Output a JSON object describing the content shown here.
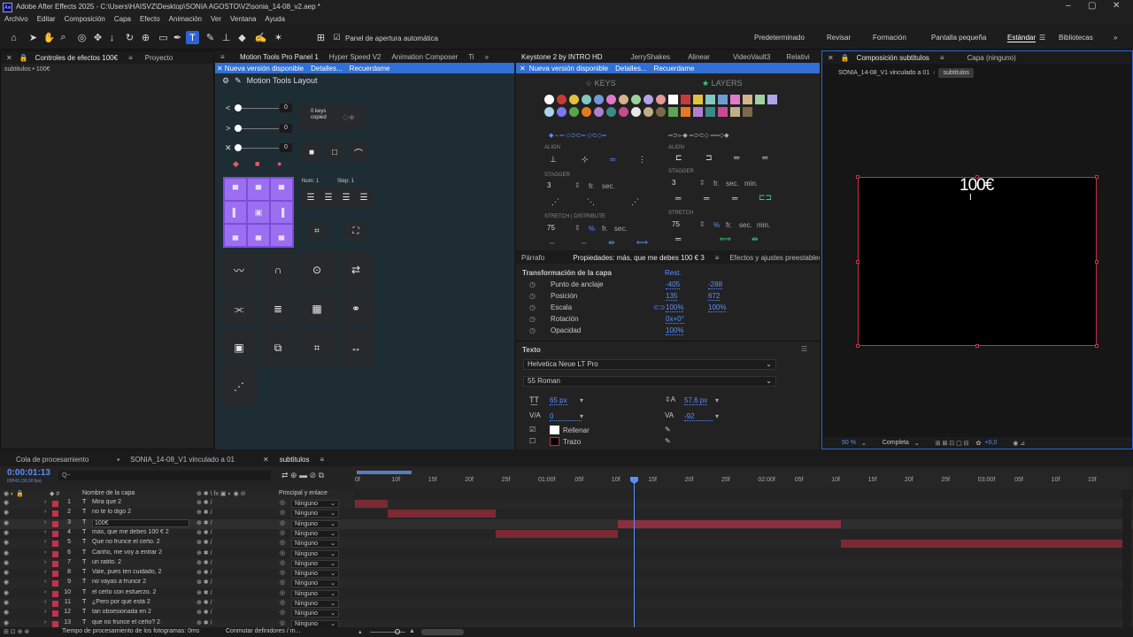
{
  "title": "Adobe After Effects 2025 - C:\\Users\\HAISVZ\\Desktop\\SONIA AGOSTO\\V2\\sonia_14-08_v2.aep *",
  "menu": [
    "Archivo",
    "Editar",
    "Composición",
    "Capa",
    "Efecto",
    "Animación",
    "Ver",
    "Ventana",
    "Ayuda"
  ],
  "toolbar": {
    "auto_open_label": "Panel de apertura automática",
    "workspaces": [
      "Predeterminado",
      "Revisar",
      "Formación",
      "Pantalla pequeña",
      "Estándar",
      "Bibliotecas"
    ],
    "active_workspace": "Estándar"
  },
  "left_panel": {
    "tabs": [
      "Controles de efectos 100€",
      "Proyecto"
    ],
    "subtitle": "subtitulos • 100€"
  },
  "motion_tools": {
    "tabs": [
      "Motion Tools Pro Panel 1",
      "Hyper Speed V2",
      "Animation Composer",
      "Ti"
    ],
    "banner": [
      "Nueva versión disponible",
      "Detalles...",
      "Recuerdame"
    ],
    "header": "Motion Tools Layout",
    "slider_values": [
      "0",
      "0",
      "0"
    ],
    "keys_copied": "0 keys copied",
    "num_label": "Num: 1",
    "step_label": "Step: 1"
  },
  "keys_panel": {
    "tabs": [
      "Keystone 2 by INTRO HD",
      "JerryShakes",
      "Alinear",
      "VideoVault3",
      "Relativi"
    ],
    "banner": [
      "Nueva versión disponible",
      "Detalles...",
      "Recuerdame"
    ],
    "keys_title": "KEYS",
    "layers_title": "LAYERS",
    "align": "ALIGN",
    "stagger": "STAGGER",
    "stagger_keys_value": "3",
    "stagger_layers_value": "3",
    "fr": "fr.",
    "sec": "sec.",
    "min": "min.",
    "stretch_distribute": "STRETCH  |  DISTRIBUTE",
    "stretch": "STRETCH",
    "stretch_keys_value": "75",
    "stretch_layers_value": "75",
    "percent": "%",
    "key_colors": [
      "#ffffff",
      "#c83a3a",
      "#e2c23a",
      "#7fc9c1",
      "#6f9ad8",
      "#e07ac9",
      "#d5b28a",
      "#9ed0a0",
      "#b2a4e8",
      "#e49a9a",
      "#a9d4e8",
      "#7a78ef",
      "#5aa54d",
      "#e67a21",
      "#b07fd0",
      "#3a8a8a",
      "#c84a91",
      "#e8e8e8",
      "#bfb08a",
      "#7a6a4a"
    ],
    "layer_colors": [
      "#ffffff",
      "#c83a3a",
      "#e2c23a",
      "#7fc9c1",
      "#6f9ad8",
      "#e07ac9",
      "#d5b28a",
      "#9ed0a0",
      "#b2a4e8",
      "#5aa54d",
      "#e67a21",
      "#b07fd0",
      "#3a8a8a",
      "#c84a91",
      "#bfb08a",
      "#7a6a4a"
    ]
  },
  "properties": {
    "tabs": [
      "Párrafo",
      "Propiedades: más, que me debes 100 € 3",
      "Efectos y ajustes preestablecidos"
    ],
    "section": "Transformación de la capa",
    "reset": "Rest.",
    "rows": [
      {
        "label": "Punto de anclaje",
        "v1": "-405",
        "v2": "-288"
      },
      {
        "label": "Posición",
        "v1": "135",
        "v2": "672"
      },
      {
        "label": "Escala",
        "v1": "100%",
        "v2": "100%"
      },
      {
        "label": "Rotación",
        "v1": "0x+0°",
        "v2": ""
      },
      {
        "label": "Opacidad",
        "v1": "100%",
        "v2": ""
      }
    ],
    "text_section": "Texto",
    "font": "Helvetica Neue LT Pro",
    "style": "55 Roman",
    "font_size": "65 px",
    "leading": "57,6 px",
    "kerning": "0",
    "tracking": "-92",
    "fill": "Rellenar",
    "stroke": "Trazo"
  },
  "composition": {
    "tabs": [
      "Composición subtitulos",
      "Capa (ninguno)"
    ],
    "breadcrumb": [
      "SONIA_14-08_V1 vinculado a 01",
      "subtitulos"
    ],
    "canvas_text": "100€",
    "zoom": "50 %",
    "quality": "Completa",
    "exposure": "+0,0"
  },
  "timeline": {
    "tabs": [
      "Cola de procesamiento",
      "SONIA_14-08_V1 vinculado a 01",
      "subtitulos"
    ],
    "timecode": "0:00:01:13",
    "timecode_sub": "00043 (30,00 fps)",
    "search_placeholder": "Q~",
    "col_name": "Nombre de la capa",
    "col_parent": "Principal y enlace",
    "ruler": [
      "0f",
      "10f",
      "15f",
      "20f",
      "25f",
      "01:00f",
      "05f",
      "10f",
      "15f",
      "20f",
      "25f",
      "02:00f",
      "05f",
      "10f",
      "15f",
      "20f",
      "25f",
      "03:00f",
      "05f",
      "10f",
      "15f"
    ],
    "layers": [
      {
        "num": "1",
        "name": "Mira que 2",
        "parent": "Ninguno",
        "start": 0.0,
        "end": 0.43
      },
      {
        "num": "2",
        "name": "no te lo digo 2",
        "parent": "Ninguno",
        "start": 0.43,
        "end": 1.83
      },
      {
        "num": "3",
        "name": "100€",
        "parent": "Ninguno",
        "start": 3.43,
        "end": 6.33
      },
      {
        "num": "4",
        "name": "más, que me debes 100 € 2",
        "parent": "Ninguno",
        "start": 1.83,
        "end": 3.43
      },
      {
        "num": "5",
        "name": "Que no frunce el ceño. 2",
        "parent": "Ninguno",
        "start": 6.33,
        "end": 10.0
      },
      {
        "num": "6",
        "name": "Cariño, me voy a entrar 2",
        "parent": "Ninguno",
        "start": 10.0,
        "end": 10.0
      },
      {
        "num": "7",
        "name": "un ratito. 2",
        "parent": "Ninguno",
        "start": 10.0,
        "end": 10.0
      },
      {
        "num": "8",
        "name": "Vale, pues ten cuidado, 2",
        "parent": "Ninguno",
        "start": 10.0,
        "end": 10.0
      },
      {
        "num": "9",
        "name": "no vayas a fruncir 2",
        "parent": "Ninguno",
        "start": 10.0,
        "end": 10.0
      },
      {
        "num": "10",
        "name": "el ceño con esfuerzo. 2",
        "parent": "Ninguno",
        "start": 10.0,
        "end": 10.0
      },
      {
        "num": "11",
        "name": "¿Pero por qué está 2",
        "parent": "Ninguno",
        "start": 10.0,
        "end": 10.0
      },
      {
        "num": "12",
        "name": "tan obsesionada en 2",
        "parent": "Ninguno",
        "start": 10.0,
        "end": 10.0
      },
      {
        "num": "13",
        "name": "que no frunce el ceño? 2",
        "parent": "Ninguno",
        "start": 10.0,
        "end": 10.0
      }
    ],
    "render_time": "Tiempo de procesamiento de los fotogramas: 0ms",
    "toggle_label": "Conmutar definidores / m..."
  }
}
